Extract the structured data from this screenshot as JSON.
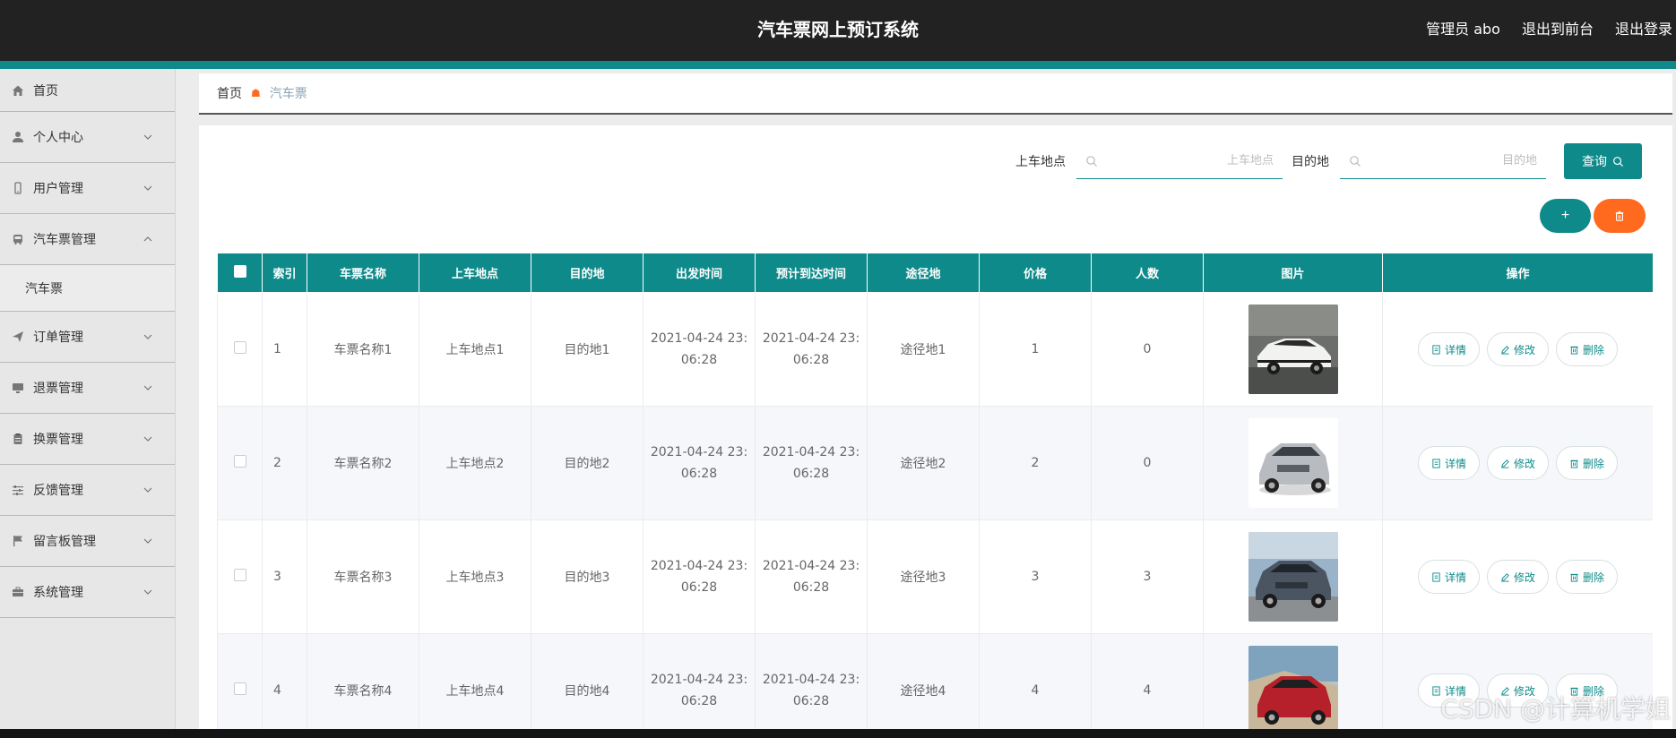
{
  "header": {
    "title": "汽车票网上预订系统",
    "admin_label": "管理员 abo",
    "front_label": "退出到前台",
    "logout_label": "退出登录"
  },
  "sidebar": {
    "items": [
      {
        "label": "首页",
        "icon": "home-icon"
      },
      {
        "label": "个人中心",
        "icon": "user-icon"
      },
      {
        "label": "用户管理",
        "icon": "phone-icon"
      },
      {
        "label": "汽车票管理",
        "icon": "bus-icon",
        "expanded": true,
        "sub": "汽车票"
      },
      {
        "label": "订单管理",
        "icon": "send-icon"
      },
      {
        "label": "退票管理",
        "icon": "monitor-icon"
      },
      {
        "label": "换票管理",
        "icon": "clipboard-icon"
      },
      {
        "label": "反馈管理",
        "icon": "sliders-icon"
      },
      {
        "label": "留言板管理",
        "icon": "flag-icon"
      },
      {
        "label": "系统管理",
        "icon": "briefcase-icon"
      }
    ]
  },
  "breadcrumb": {
    "home": "首页",
    "current": "汽车票"
  },
  "search": {
    "from_label": "上车地点",
    "from_placeholder": "上车地点",
    "to_label": "目的地",
    "to_placeholder": "目的地",
    "query_label": "查询"
  },
  "actions": {
    "add_symbol": "+"
  },
  "table": {
    "headers": [
      "索引",
      "车票名称",
      "上车地点",
      "目的地",
      "出发时间",
      "预计到达时间",
      "途径地",
      "价格",
      "人数",
      "图片",
      "操作"
    ],
    "ops": {
      "detail": "详情",
      "edit": "修改",
      "delete": "删除"
    },
    "rows": [
      {
        "index": "1",
        "name": "车票名称1",
        "from": "上车地点1",
        "to": "目的地1",
        "depart_a": "2021-04-24 23:",
        "depart_b": "06:28",
        "arrive_a": "2021-04-24 23:",
        "arrive_b": "06:28",
        "via": "途径地1",
        "price": "1",
        "count": "0",
        "image": "white-sedan"
      },
      {
        "index": "2",
        "name": "车票名称2",
        "from": "上车地点2",
        "to": "目的地2",
        "depart_a": "2021-04-24 23:",
        "depart_b": "06:28",
        "arrive_a": "2021-04-24 23:",
        "arrive_b": "06:28",
        "via": "途径地2",
        "price": "2",
        "count": "0",
        "image": "silver-suv"
      },
      {
        "index": "3",
        "name": "车票名称3",
        "from": "上车地点3",
        "to": "目的地3",
        "depart_a": "2021-04-24 23:",
        "depart_b": "06:28",
        "arrive_a": "2021-04-24 23:",
        "arrive_b": "06:28",
        "via": "途径地3",
        "price": "3",
        "count": "3",
        "image": "grey-suv"
      },
      {
        "index": "4",
        "name": "车票名称4",
        "from": "上车地点4",
        "to": "目的地4",
        "depart_a": "2021-04-24 23:",
        "depart_b": "06:28",
        "arrive_a": "2021-04-24 23:",
        "arrive_b": "06:28",
        "via": "途径地4",
        "price": "4",
        "count": "4",
        "image": "red-suv"
      }
    ]
  },
  "watermark": "CSDN @计算机学姐",
  "colors": {
    "primary": "#0f8a8a",
    "danger": "#ff6a1f",
    "header_bg": "#222222"
  }
}
